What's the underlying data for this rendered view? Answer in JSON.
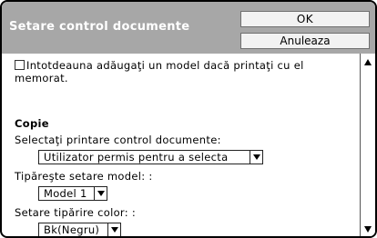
{
  "header": {
    "title": "Setare control documente",
    "ok_label": "OK",
    "cancel_label": "Anuleaza"
  },
  "options": {
    "always_add_label": "Intotdeauna adăugaţi un model dacă printaţi cu el memorat.",
    "always_add_checked": false
  },
  "copy": {
    "section_title": "Copie",
    "select_printer_label": "Selectaţi printare control documente:",
    "select_printer_value": "Utilizator permis pentru a selecta",
    "print_model_label": "Tipăreşte setare model: :",
    "print_model_value": "Model 1",
    "color_label": "Setare tipărire color: :",
    "color_value": "Bk(Negru)"
  },
  "colors": {
    "header_bg": "#a7a7a7",
    "header_text": "#ffffff"
  }
}
